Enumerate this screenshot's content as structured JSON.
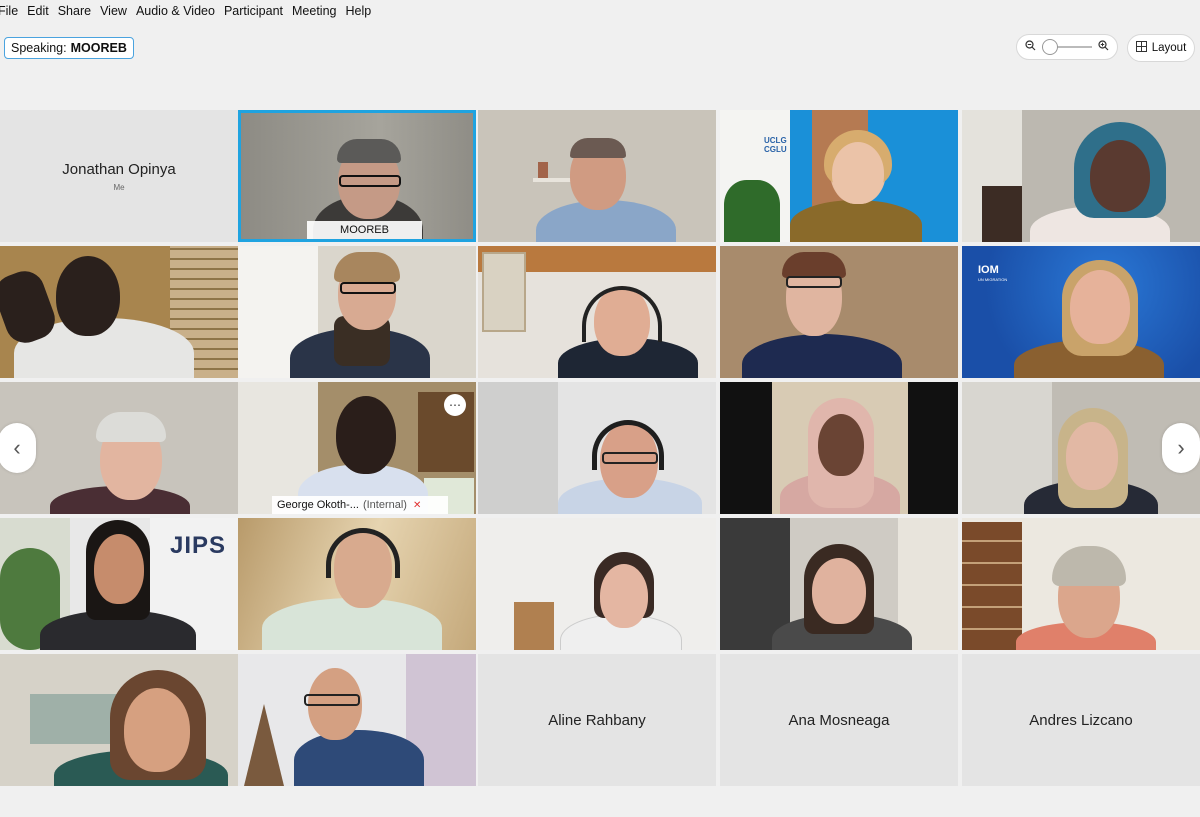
{
  "menu": [
    "File",
    "Edit",
    "Share",
    "View",
    "Audio & Video",
    "Participant",
    "Meeting",
    "Help"
  ],
  "speaking": {
    "label": "Speaking:",
    "name": "MOOREB"
  },
  "layout_label": "Layout",
  "icons": {
    "zoom_out": "zoom-out-icon",
    "zoom_in": "zoom-in-icon",
    "layout": "grid-layout-icon",
    "prev": "chevron-left-icon",
    "next": "chevron-right-icon",
    "more": "more-options-icon",
    "mic": "mic-muted-icon"
  },
  "tiles": {
    "jonathan": {
      "name": "Jonathan Opinya",
      "sub": "Me"
    },
    "mooreb": {
      "tag": "MOOREB"
    },
    "uclg": {
      "logo": "UCLG CGLU"
    },
    "iom": {
      "logo": "IOM",
      "sublogo": "UN MIGRATION"
    },
    "george": {
      "tag": "George Okoth-...",
      "tag_extra": "(Internal)"
    },
    "jips": {
      "logo": "JIPS"
    },
    "aline": {
      "name": "Aline Rahbany"
    },
    "ana": {
      "name": "Ana Mosneaga"
    },
    "andres": {
      "name": "Andres Lizcano"
    }
  },
  "colors": {
    "accent": "#1fa3e0",
    "tile_empty": "#e4e4e4",
    "mic_red": "#e03030"
  }
}
